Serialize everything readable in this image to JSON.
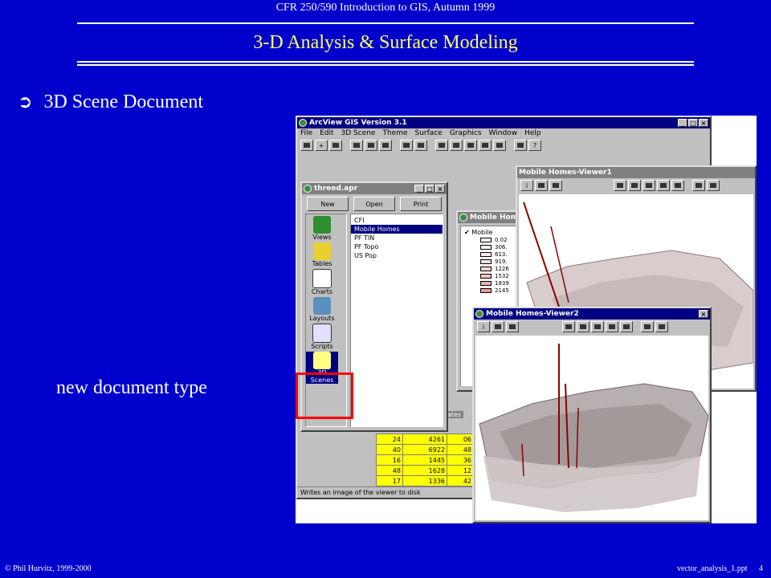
{
  "slide": {
    "header": "CFR 250/590 Introduction to GIS, Autumn 1999",
    "title": "3-D Analysis & Surface Modeling",
    "bullet_arrow": "➲",
    "bullet_text": "3D Scene Document",
    "caption": "new document type",
    "footer_left": "© Phil Hurvitz, 1999-2000",
    "footer_right": "vector_analysis_1.ppt",
    "page_number": "4"
  },
  "arcview": {
    "title": "ArcView GIS Version 3.1",
    "menu": [
      "File",
      "Edit",
      "3D Scene",
      "Theme",
      "Surface",
      "Graphics",
      "Window",
      "Help"
    ],
    "status": "Writes an image of the viewer to disk",
    "win_buttons": [
      "_",
      "□",
      "×"
    ]
  },
  "project": {
    "title": "threed.apr",
    "buttons": [
      "New",
      "Open",
      "Print"
    ],
    "doc_types": [
      "Views",
      "Tables",
      "Charts",
      "Layouts",
      "Scripts",
      "3D Scenes"
    ],
    "scenes": [
      "CFI",
      "Mobile Homes",
      "PF TIN",
      "PF Topo",
      "US Pop"
    ],
    "selected_scene": "Mobile Homes"
  },
  "mobile_homes_view": {
    "title": "Mobile Homes",
    "legend_title": "Mobile",
    "legend_values": [
      "0.02",
      "306.",
      "613.",
      "919.",
      "1226",
      "1532",
      "1839",
      "2145"
    ]
  },
  "attr_table": {
    "title_fragment": "ates",
    "rows": [
      [
        "24",
        "4261",
        "06"
      ],
      [
        "40",
        "6922",
        "48"
      ],
      [
        "16",
        "1445",
        "36"
      ],
      [
        "48",
        "1628",
        "12"
      ],
      [
        "17",
        "1336",
        "42"
      ]
    ]
  },
  "viewer1": {
    "title": "Mobile Homes-Viewer1"
  },
  "viewer2": {
    "title": "Mobile Homes-Viewer2"
  },
  "colors": {
    "slide_bg": "#0000cc",
    "title": "#ffff66",
    "highlight_box": "#ff0000",
    "titlebar_active": "#000080"
  }
}
